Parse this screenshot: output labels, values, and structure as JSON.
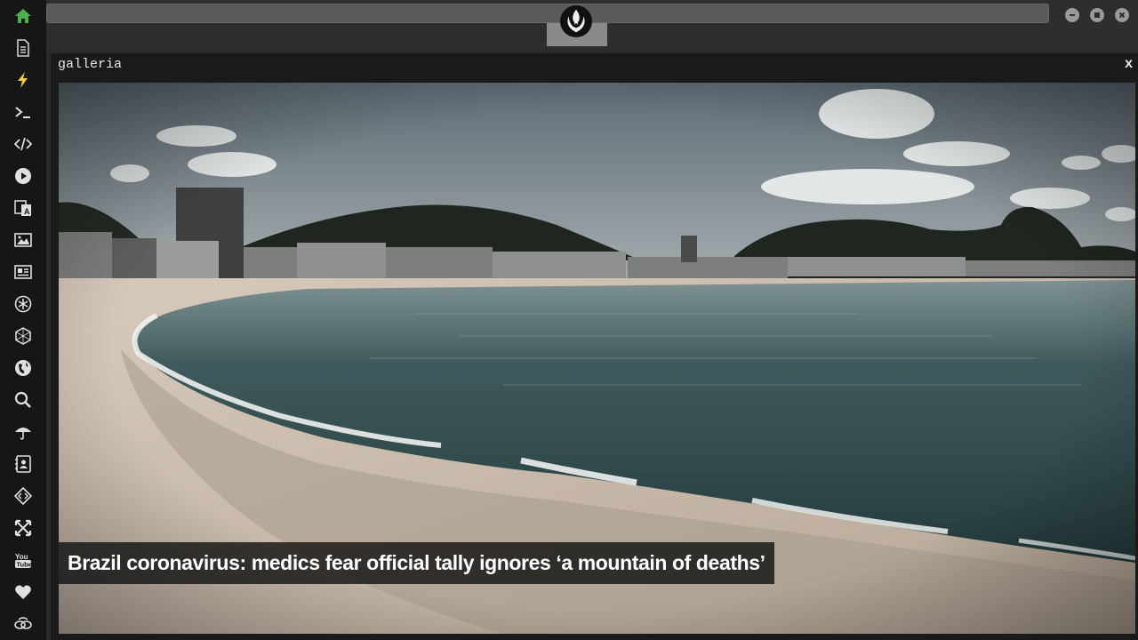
{
  "window": {
    "title": "galleria",
    "close_label": "x"
  },
  "gallery": {
    "caption": "Brazil coronavirus: medics fear official tally ignores ‘a mountain of deaths’"
  },
  "sidebar": {
    "icons": [
      "home-icon",
      "document-icon",
      "lightning-icon",
      "terminal-icon",
      "code-icon",
      "play-icon",
      "translate-icon",
      "image-icon",
      "news-icon",
      "asterisk-icon",
      "hexagon-icon",
      "globe-icon",
      "search-icon",
      "umbrella-icon",
      "contacts-icon",
      "diamond-code-icon",
      "expand-icon",
      "youtube-icon",
      "heart-icon",
      "link-icon"
    ],
    "home_color": "#4caf50",
    "lightning_color": "#f2c94c"
  }
}
